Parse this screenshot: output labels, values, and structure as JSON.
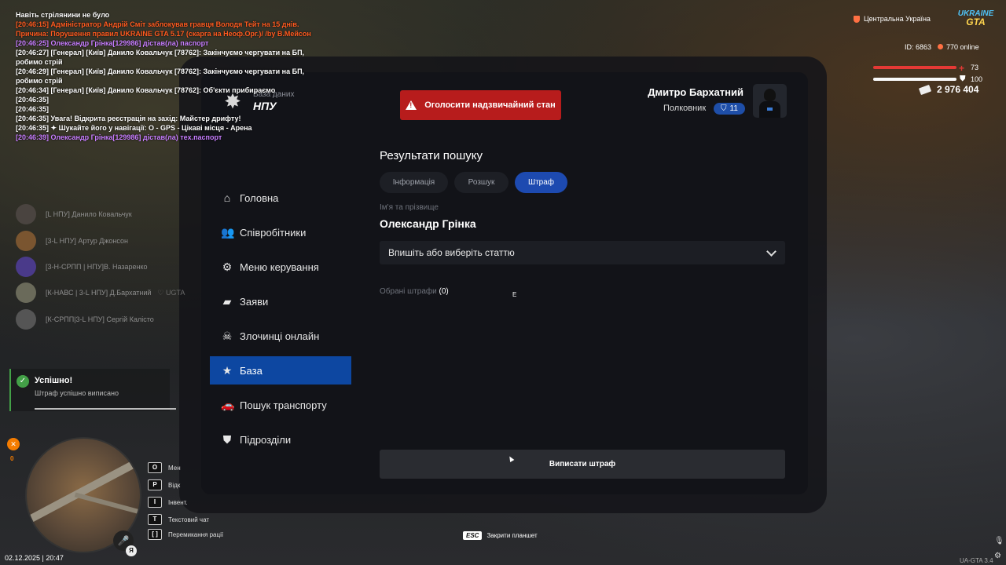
{
  "tablet": {
    "logo_sub": "База даних",
    "logo_main": "НПУ",
    "emergency_button": "Оголосити надзвичайний стан",
    "user": {
      "name": "Дмитро Бархатний",
      "rank": "Полковник",
      "level": "11"
    },
    "sidebar": [
      {
        "label": "Головна",
        "icon": "home-icon"
      },
      {
        "label": "Співробітники",
        "icon": "people-icon"
      },
      {
        "label": "Меню керування",
        "icon": "gear-icon"
      },
      {
        "label": "Заяви",
        "icon": "folder-icon"
      },
      {
        "label": "Злочинці онлайн",
        "icon": "skull-icon"
      },
      {
        "label": "База",
        "icon": "star-icon",
        "active": true
      },
      {
        "label": "Пошук транспорту",
        "icon": "car-icon"
      },
      {
        "label": "Підрозділи",
        "icon": "shield-icon"
      }
    ],
    "results_title": "Результати пошуку",
    "tabs": [
      {
        "label": "Інформація"
      },
      {
        "label": "Розшук"
      },
      {
        "label": "Штраф",
        "active": true
      }
    ],
    "name_label": "Ім'я та прізвище",
    "name_value": "Олександр Грінка",
    "select_placeholder": "Впишіть або виберіть статтю",
    "chosen_label": "Обрані штрафи",
    "chosen_count": "(0)",
    "cursor_letter": "E",
    "submit_button": "Виписати штраф"
  },
  "chat": [
    {
      "text": "Навіть стрілянини не було",
      "color": "#ffffff"
    },
    {
      "text": "[20:46:15] Адміністратор Андрій Сміт заблокував гравця Володя Тейт на 15 днів. Причина: Порушення правил UKRAINE GTA 5.17 (скарга на Неоф.Орг.)/ /by В.Мейсон",
      "color": "#ff5a1f"
    },
    {
      "text": "[20:46:25] Олександр Грінка[129986] дістав(ла) паспорт",
      "color": "#c77dff"
    },
    {
      "text": "[20:46:27] [Генерал] [Київ] Данило Ковальчук [78762]: Закінчуємо чергувати на БП, робимо стрій",
      "color": "#ffffff"
    },
    {
      "text": "[20:46:29] [Генерал] [Київ] Данило Ковальчук [78762]: Закінчуємо чергувати на БП, робимо стрій",
      "color": "#ffffff"
    },
    {
      "text": "[20:46:34] [Генерал] [Київ] Данило Ковальчук [78762]: Об'єкти прибираємо",
      "color": "#ffffff"
    },
    {
      "text": "[20:46:35]",
      "color": "#ffffff"
    },
    {
      "text": "[20:46:35]",
      "color": "#ffffff"
    },
    {
      "text": "[20:46:35] Увага! Відкрита реєстрація на захід: Майстер дрифту!",
      "color": "#ffffff"
    },
    {
      "text": "[20:46:35] ✦ Шукайте його у навігації: О - GPS - Цікаві місця - Арена",
      "color": "#ffffff"
    },
    {
      "text": "[20:46:39] Олександр Грінка[129986] дістав(ла) тех.паспорт",
      "color": "#c77dff"
    }
  ],
  "members": [
    {
      "name": "[L НПУ] Данило Ковальчук",
      "extra": ""
    },
    {
      "name": "[3-L НПУ] Артур Джонсон",
      "extra": ""
    },
    {
      "name": "[3-Н-СРПП | НПУ]В. Назаренко",
      "extra": ""
    },
    {
      "name": "[К-НАВС | 3-L НПУ] Д.Бархатний",
      "extra": "♡ UGTA"
    },
    {
      "name": "[К-СРПП|3-L НПУ] Сергій Калісто",
      "extra": ""
    }
  ],
  "notification": {
    "title": "Успішно!",
    "message": "Штраф успішно виписано"
  },
  "hints": [
    {
      "key": "O",
      "label": "Мен"
    },
    {
      "key": "P",
      "label": "Відк"
    },
    {
      "key": "I",
      "label": "Інвент."
    },
    {
      "key": "T",
      "label": "Текстовий чат"
    },
    {
      "key": "[ ]",
      "label": "Перемикання рації"
    }
  ],
  "datetime": "02.12.2025 | 20:47",
  "tool_count": "0",
  "esc_key": "ESC",
  "esc_label": "Закрити планшет",
  "hud": {
    "region": "Центральна Україна",
    "logo_top": "UKRAINE",
    "logo_bottom": "GTA",
    "id": "ID: 6863",
    "online": "770 online",
    "health": "73",
    "armor": "100",
    "money": "2 976 404",
    "version": "UA-GTA 3.4"
  }
}
